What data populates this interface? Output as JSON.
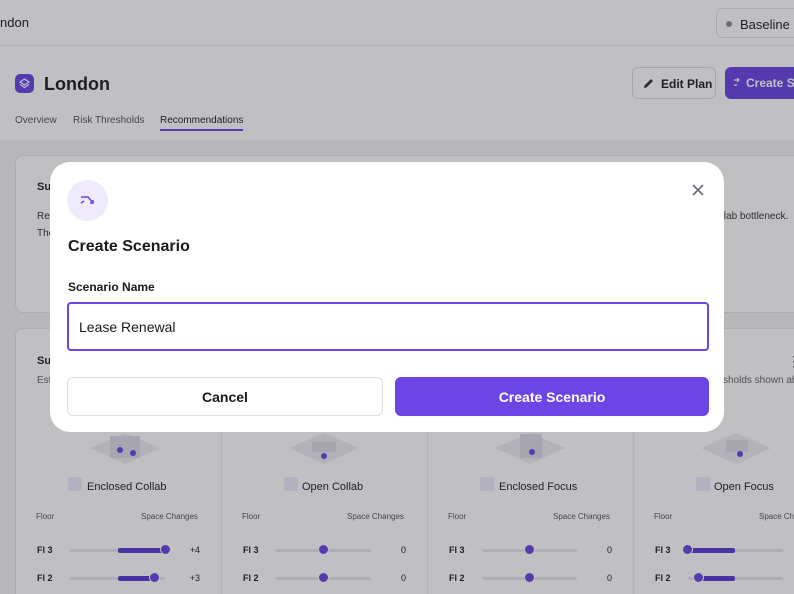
{
  "topbar": {
    "location_partial": "ndon",
    "baseline_label": "Baseline"
  },
  "header": {
    "title": "London",
    "edit_plan_label": "Edit Plan",
    "create_scenario_partial": "Create Sc"
  },
  "tabs": [
    {
      "label": "Overview"
    },
    {
      "label": "Risk Thresholds"
    },
    {
      "label": "Recommendations"
    }
  ],
  "summary_card": {
    "title_partial": "Su",
    "line1_partial": "Rec",
    "line2_partial": "The",
    "right_text_partial": "ollab bottleneck."
  },
  "spaces_card": {
    "title_partial": "Su",
    "subtitle_partial": "Est",
    "right_text_partial": "sholds shown ab",
    "menu_glyph": "⋮",
    "floor_header": "Floor",
    "space_changes_header": "Space Changes",
    "columns": [
      {
        "name": "Enclosed Collab",
        "icon": "group-icon",
        "rows": [
          {
            "floor": "Fl 3",
            "value": "+4"
          },
          {
            "floor": "Fl 2",
            "value": "+3"
          }
        ]
      },
      {
        "name": "Open Collab",
        "icon": "people-icon",
        "rows": [
          {
            "floor": "Fl 3",
            "value": "0"
          },
          {
            "floor": "Fl 2",
            "value": "0"
          }
        ]
      },
      {
        "name": "Enclosed Focus",
        "icon": "person-box-icon",
        "rows": [
          {
            "floor": "Fl 3",
            "value": "0"
          },
          {
            "floor": "Fl 2",
            "value": "0"
          }
        ]
      },
      {
        "name": "Open Focus",
        "icon": "person-icon",
        "rows": [
          {
            "floor": "Fl 3",
            "value": ""
          },
          {
            "floor": "Fl 2",
            "value": ""
          }
        ]
      }
    ]
  },
  "modal": {
    "title": "Create Scenario",
    "field_label": "Scenario Name",
    "input_value": "Lease Renewal",
    "cancel_label": "Cancel",
    "submit_label": "Create Scenario"
  },
  "colors": {
    "accent": "#6b46e5",
    "overlay": "rgba(28,28,36,0.28)"
  }
}
